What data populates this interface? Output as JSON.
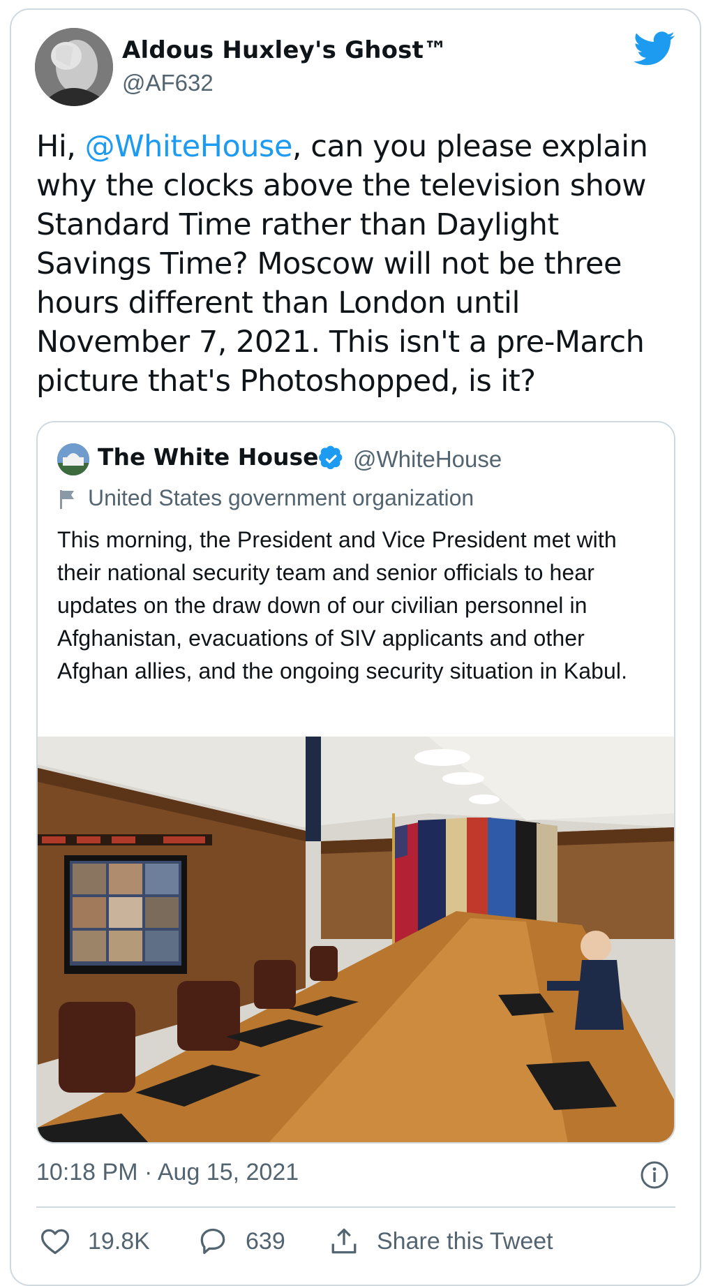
{
  "author": {
    "name": "Aldous Huxley's Ghost™",
    "handle": "@AF632"
  },
  "tweet": {
    "prefix": "Hi, ",
    "mention": "@WhiteHouse",
    "body": ", can you please explain why the clocks above the television show Standard Time rather than Daylight Savings Time? Moscow will not be three hours different than London until November 7, 2021. This isn't a pre-March picture that's Photoshopped, is it?"
  },
  "quoted": {
    "name": "The White House",
    "handle": "@WhiteHouse",
    "label": "United States government organization",
    "text": "This morning, the President and Vice President met with their national security team and senior officials to hear updates on the draw down of our civilian personnel in Afghanistan, evacuations of SIV applicants and other Afghan allies, and the ongoing security situation in Kabul."
  },
  "meta": {
    "timestamp": "10:18 PM · Aug 15, 2021"
  },
  "actions": {
    "likes": "19.8K",
    "replies": "639",
    "share_label": "Share this Tweet"
  },
  "colors": {
    "accent": "#1d9bf0",
    "secondary_text": "#536471",
    "border": "#cfd9de"
  },
  "icons": [
    "twitter-bird-icon",
    "verified-badge-icon",
    "flag-icon",
    "info-icon",
    "heart-icon",
    "reply-icon",
    "share-icon"
  ]
}
